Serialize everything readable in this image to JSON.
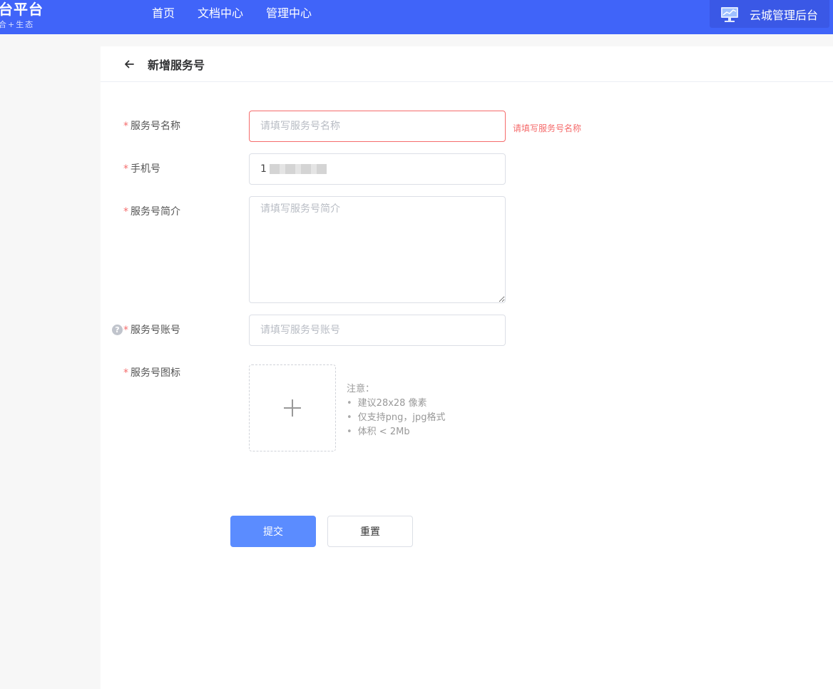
{
  "header": {
    "logo_title": "台平台",
    "logo_subtitle": "合+生态",
    "nav": [
      {
        "label": "首页"
      },
      {
        "label": "文档中心"
      },
      {
        "label": "管理中心"
      }
    ],
    "console_label": "云城管理后台",
    "console_icon": "monitor-icon",
    "background_color": "#4064f9"
  },
  "page": {
    "title": "新增服务号",
    "back_icon": "arrow-left-icon"
  },
  "form": {
    "required_mark": "*",
    "name": {
      "label": "服务号名称",
      "placeholder": "请填写服务号名称",
      "value": "",
      "error": "请填写服务号名称"
    },
    "phone": {
      "label": "手机号",
      "value": "1"
    },
    "intro": {
      "label": "服务号简介",
      "placeholder": "请填写服务号简介",
      "value": ""
    },
    "account": {
      "label": "服务号账号",
      "placeholder": "请填写服务号账号",
      "value": "",
      "help_icon": "question-circle-icon",
      "help_glyph": "?"
    },
    "icon": {
      "label": "服务号图标",
      "upload_icon": "plus-icon",
      "notes_title": "注意：",
      "notes": [
        "建议28x28 像素",
        "仅支持png，jpg格式",
        "体积 < 2Mb"
      ]
    },
    "submit_label": "提交",
    "reset_label": "重置"
  },
  "colors": {
    "primary": "#5b8cff",
    "error": "#f56c6c",
    "required": "#f56c6c"
  }
}
